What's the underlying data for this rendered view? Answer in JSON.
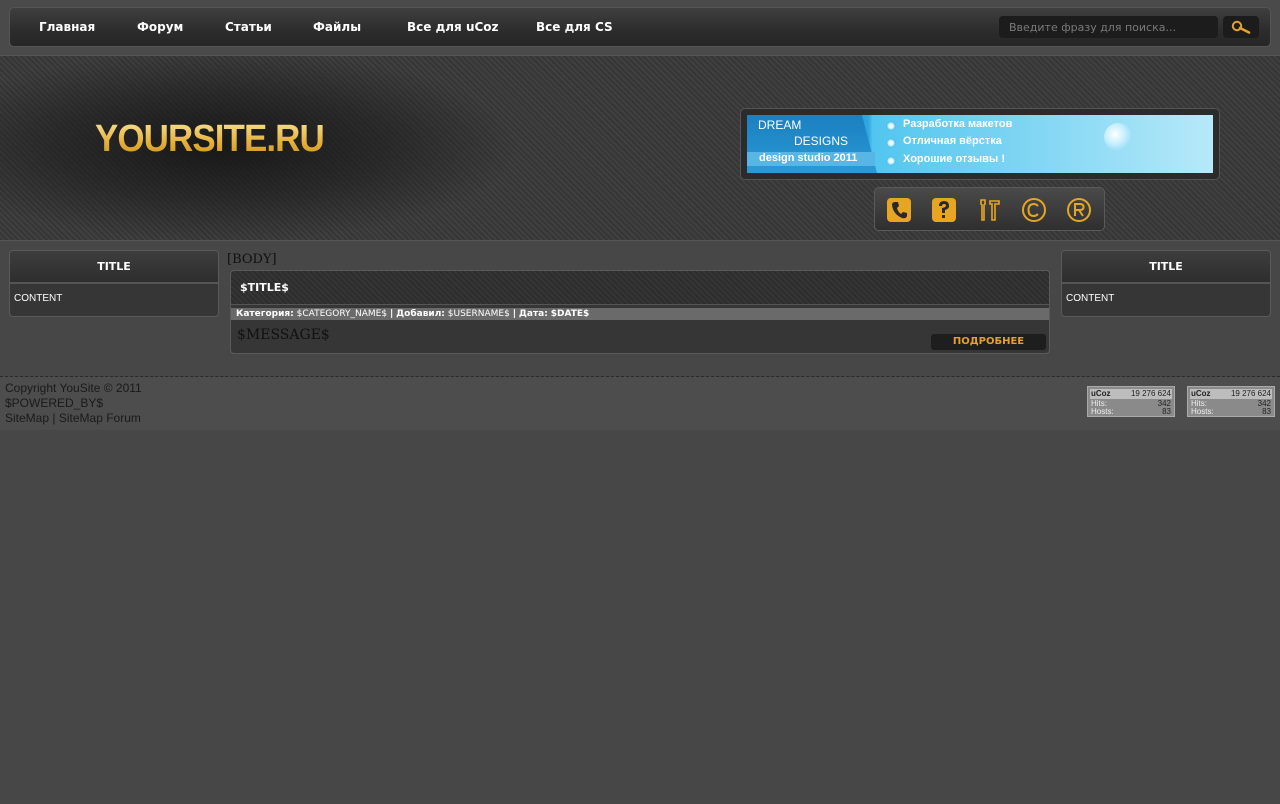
{
  "nav": {
    "items": [
      "Главная",
      "Форум",
      "Статьи",
      "Файлы",
      "Все для uCoz",
      "Все для CS"
    ],
    "search_placeholder": "Введите фразу для поиска..."
  },
  "header": {
    "logo_text": "YOURSITE.RU",
    "banner": {
      "line1": "DREAM",
      "line2": "DESIGNS",
      "studio": "design studio 2011",
      "bullets": [
        "Разработка макетов",
        "Отличная вёрстка",
        "Хорошие отзывы !"
      ]
    },
    "icons": [
      "phone-icon",
      "help-icon",
      "tools-icon",
      "copyright-icon",
      "registered-icon"
    ]
  },
  "left_block": {
    "title": "TITLE",
    "content": "CONTENT"
  },
  "right_block": {
    "title": "TITLE",
    "content": "CONTENT"
  },
  "main": {
    "body_label": "[BODY]",
    "entry": {
      "title": "$TITLE$",
      "category_label": "Категория:",
      "category_value": "$CATEGORY_NAME$",
      "author_label": "Добавил:",
      "author_value": "$USERNAME$",
      "date_label": "Дата:",
      "date_value": "$DATE$",
      "separator": "|",
      "message": "$MESSAGE$",
      "more_label": "ПОДРОБНЕЕ"
    }
  },
  "footer": {
    "copyright": "Copyright YouSite © 2011",
    "powered": "$POWERED_BY$",
    "sitemap": "SiteMap",
    "sitemap_sep": "|",
    "sitemap_forum": "SiteMap Forum",
    "counters": [
      {
        "logo": "uCoz",
        "total": "19 276 624",
        "hits_label": "Hits:",
        "hits": "342",
        "hosts_label": "Hosts:",
        "hosts": "83"
      },
      {
        "logo": "uCoz",
        "total": "19 276 624",
        "hits_label": "Hits:",
        "hits": "342",
        "hosts_label": "Hosts:",
        "hosts": "83"
      }
    ]
  },
  "colors": {
    "accent": "#e6a12a",
    "background": "#474747",
    "panel": "#363636"
  }
}
